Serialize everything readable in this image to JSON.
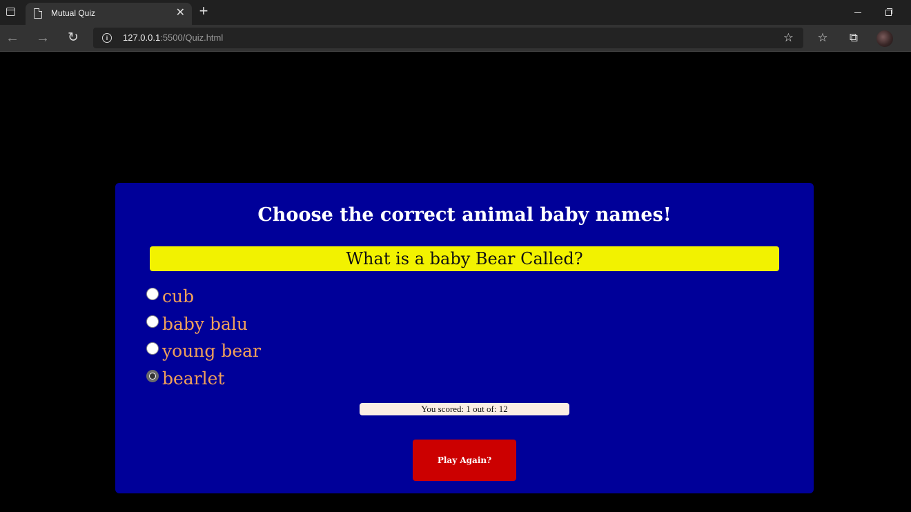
{
  "browser": {
    "tab_title": "Mutual Quiz",
    "tab_close": "✕",
    "new_tab": "+",
    "url_host": "127.0.0.1",
    "url_rest": ":5500/Quiz.html",
    "icons": {
      "tab_actions": "tab-actions-icon",
      "page": "page-icon",
      "back": "back-arrow-icon",
      "forward": "forward-arrow-icon",
      "reload": "reload-icon",
      "site_info": "info-icon",
      "favorite": "add-favorite-icon",
      "favorites": "favorites-icon",
      "collections": "collections-icon",
      "profile": "profile-avatar"
    }
  },
  "quiz": {
    "heading": "Choose the correct animal baby names!",
    "question": "What is a baby Bear Called?",
    "answers": [
      {
        "label": "cub",
        "checked": false
      },
      {
        "label": "baby balu",
        "checked": false
      },
      {
        "label": "young bear",
        "checked": false
      },
      {
        "label": "bearlet",
        "checked": true
      }
    ],
    "score_text": "You scored: 1 out of: 12",
    "play_again_label": "Play Again?"
  },
  "colors": {
    "card_bg": "#000099",
    "question_bg": "#f2f200",
    "answer_text": "#f0a05a",
    "score_bg": "#fbeee4",
    "button_bg": "#cc0000"
  }
}
